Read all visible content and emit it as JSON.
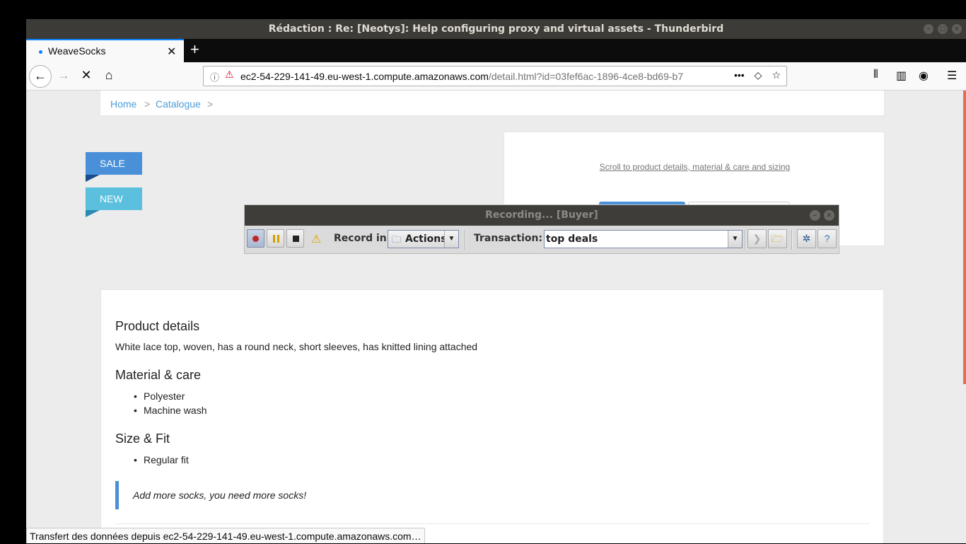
{
  "window": {
    "title": "Rédaction : Re: [Neotys]: Help configuring proxy and virtual assets - Thunderbird"
  },
  "browser": {
    "tab_title": "WeaveSocks",
    "url_host": "ec2-54-229-141-49.eu-west-1.compute.amazonaws.com",
    "url_path": "/detail.html?id=03fef6ac-1896-4ce8-bd69-b7",
    "status": "Transfert des données depuis ec2-54-229-141-49.eu-west-1.compute.amazonaws.com…"
  },
  "breadcrumb": {
    "home": "Home",
    "sep1": ">",
    "catalogue": "Catalogue",
    "sep2": ">"
  },
  "ribbons": {
    "sale": "SALE",
    "new": "NEW"
  },
  "buy": {
    "scroll_link": "Scroll to product details, material & care and sizing"
  },
  "recorder": {
    "title": "Recording... [Buyer]",
    "record_in_label": "Record in:",
    "record_in_value": "Actions",
    "transaction_label": "Transaction:",
    "transaction_value": "top deals"
  },
  "details": {
    "product_heading": "Product details",
    "product_text": "White lace top, woven, has a round neck, short sleeves, has knitted lining attached",
    "material_heading": "Material & care",
    "material_items": [
      "Polyester",
      "Machine wash"
    ],
    "size_heading": "Size & Fit",
    "size_items": [
      "Regular fit"
    ],
    "quote": "Add more socks, you need more socks!"
  }
}
